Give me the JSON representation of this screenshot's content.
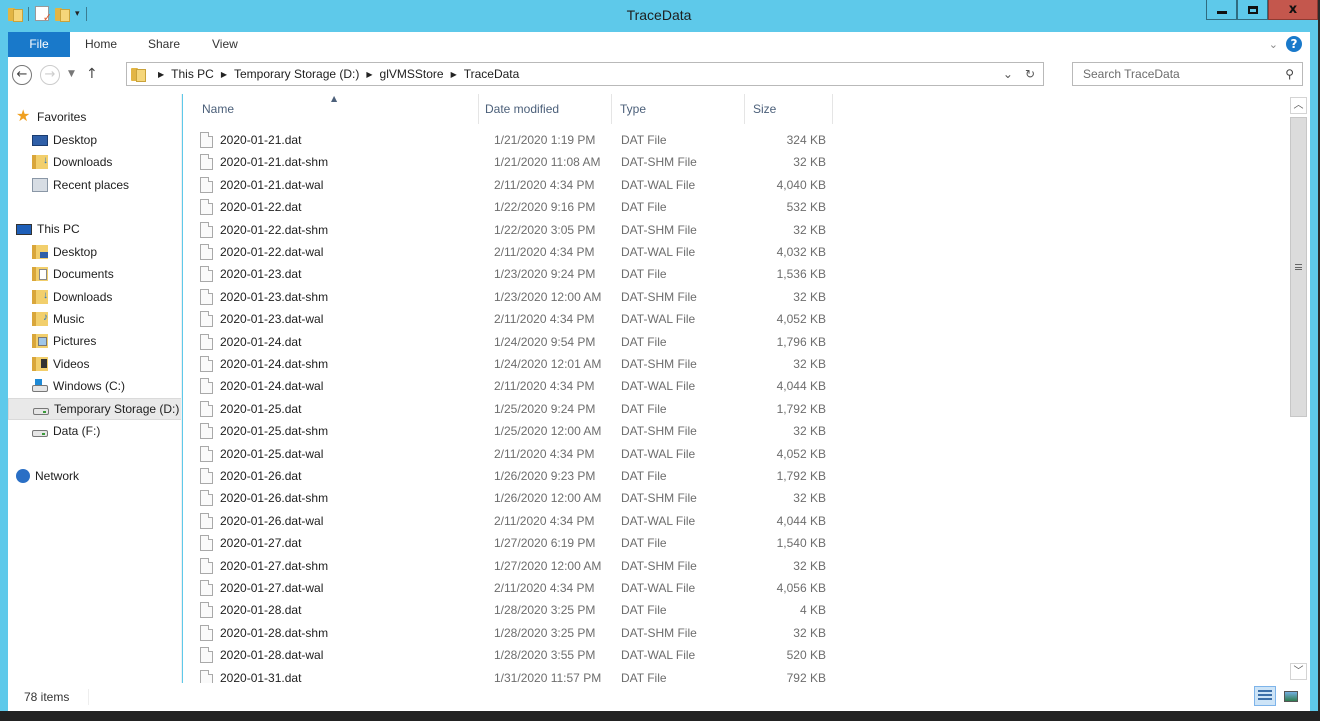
{
  "window": {
    "title": "TraceData",
    "minimize_icon": "minimize-icon",
    "maximize_icon": "maximize-icon",
    "close_label": "x"
  },
  "colors": {
    "titlebar": "#5ec9ea",
    "file_tab": "#1979ca",
    "close_button": "#c4574d",
    "selection": "#e9e9e9"
  },
  "ribbon": {
    "tabs": [
      {
        "label": "File"
      },
      {
        "label": "Home"
      },
      {
        "label": "Share"
      },
      {
        "label": "View"
      }
    ],
    "help_label": "?"
  },
  "address": {
    "back_icon": "←",
    "forward_icon": "→",
    "up_icon": "↑",
    "breadcrumb": [
      "This PC",
      "Temporary Storage (D:)",
      "glVMSStore",
      "TraceData"
    ],
    "refresh_icon": "↻",
    "dropdown_icon": "⌄"
  },
  "search": {
    "placeholder": "Search TraceData"
  },
  "nav": {
    "favorites": "Favorites",
    "fav_items": [
      "Desktop",
      "Downloads",
      "Recent places"
    ],
    "this_pc": "This PC",
    "pc_items": [
      "Desktop",
      "Documents",
      "Downloads",
      "Music",
      "Pictures",
      "Videos",
      "Windows (C:)",
      "Temporary Storage (D:)",
      "Data (F:)"
    ],
    "network": "Network"
  },
  "columns": {
    "name": "Name",
    "date": "Date modified",
    "type": "Type",
    "size": "Size"
  },
  "files": [
    {
      "name": "2020-01-21.dat",
      "date": "1/21/2020 1:19 PM",
      "type": "DAT File",
      "size": "324 KB"
    },
    {
      "name": "2020-01-21.dat-shm",
      "date": "1/21/2020 11:08 AM",
      "type": "DAT-SHM File",
      "size": "32 KB"
    },
    {
      "name": "2020-01-21.dat-wal",
      "date": "2/11/2020 4:34 PM",
      "type": "DAT-WAL File",
      "size": "4,040 KB"
    },
    {
      "name": "2020-01-22.dat",
      "date": "1/22/2020 9:16 PM",
      "type": "DAT File",
      "size": "532 KB"
    },
    {
      "name": "2020-01-22.dat-shm",
      "date": "1/22/2020 3:05 PM",
      "type": "DAT-SHM File",
      "size": "32 KB"
    },
    {
      "name": "2020-01-22.dat-wal",
      "date": "2/11/2020 4:34 PM",
      "type": "DAT-WAL File",
      "size": "4,032 KB"
    },
    {
      "name": "2020-01-23.dat",
      "date": "1/23/2020 9:24 PM",
      "type": "DAT File",
      "size": "1,536 KB"
    },
    {
      "name": "2020-01-23.dat-shm",
      "date": "1/23/2020 12:00 AM",
      "type": "DAT-SHM File",
      "size": "32 KB"
    },
    {
      "name": "2020-01-23.dat-wal",
      "date": "2/11/2020 4:34 PM",
      "type": "DAT-WAL File",
      "size": "4,052 KB"
    },
    {
      "name": "2020-01-24.dat",
      "date": "1/24/2020 9:54 PM",
      "type": "DAT File",
      "size": "1,796 KB"
    },
    {
      "name": "2020-01-24.dat-shm",
      "date": "1/24/2020 12:01 AM",
      "type": "DAT-SHM File",
      "size": "32 KB"
    },
    {
      "name": "2020-01-24.dat-wal",
      "date": "2/11/2020 4:34 PM",
      "type": "DAT-WAL File",
      "size": "4,044 KB"
    },
    {
      "name": "2020-01-25.dat",
      "date": "1/25/2020 9:24 PM",
      "type": "DAT File",
      "size": "1,792 KB"
    },
    {
      "name": "2020-01-25.dat-shm",
      "date": "1/25/2020 12:00 AM",
      "type": "DAT-SHM File",
      "size": "32 KB"
    },
    {
      "name": "2020-01-25.dat-wal",
      "date": "2/11/2020 4:34 PM",
      "type": "DAT-WAL File",
      "size": "4,052 KB"
    },
    {
      "name": "2020-01-26.dat",
      "date": "1/26/2020 9:23 PM",
      "type": "DAT File",
      "size": "1,792 KB"
    },
    {
      "name": "2020-01-26.dat-shm",
      "date": "1/26/2020 12:00 AM",
      "type": "DAT-SHM File",
      "size": "32 KB"
    },
    {
      "name": "2020-01-26.dat-wal",
      "date": "2/11/2020 4:34 PM",
      "type": "DAT-WAL File",
      "size": "4,044 KB"
    },
    {
      "name": "2020-01-27.dat",
      "date": "1/27/2020 6:19 PM",
      "type": "DAT File",
      "size": "1,540 KB"
    },
    {
      "name": "2020-01-27.dat-shm",
      "date": "1/27/2020 12:00 AM",
      "type": "DAT-SHM File",
      "size": "32 KB"
    },
    {
      "name": "2020-01-27.dat-wal",
      "date": "2/11/2020 4:34 PM",
      "type": "DAT-WAL File",
      "size": "4,056 KB"
    },
    {
      "name": "2020-01-28.dat",
      "date": "1/28/2020 3:25 PM",
      "type": "DAT File",
      "size": "4 KB"
    },
    {
      "name": "2020-01-28.dat-shm",
      "date": "1/28/2020 3:25 PM",
      "type": "DAT-SHM File",
      "size": "32 KB"
    },
    {
      "name": "2020-01-28.dat-wal",
      "date": "1/28/2020 3:55 PM",
      "type": "DAT-WAL File",
      "size": "520 KB"
    },
    {
      "name": "2020-01-31.dat",
      "date": "1/31/2020 11:57 PM",
      "type": "DAT File",
      "size": "792 KB"
    }
  ],
  "status": {
    "item_count": "78 items"
  }
}
